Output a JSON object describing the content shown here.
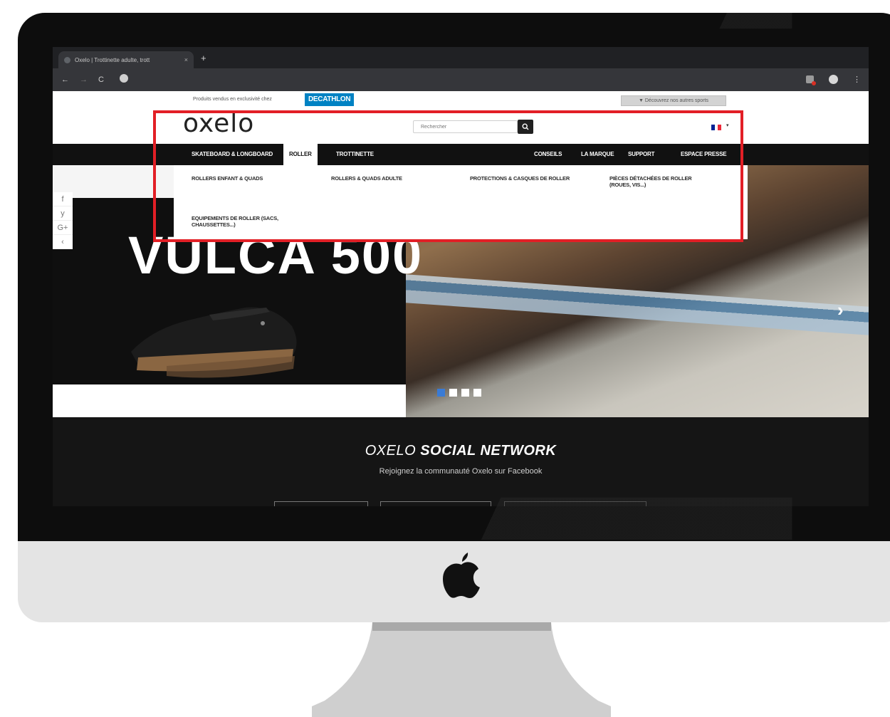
{
  "browser": {
    "tab_title": "Oxelo | Trottinette adulte, trott",
    "tab_close": "×",
    "new_tab": "+",
    "back": "←",
    "forward": "→",
    "reload": "C",
    "menu": "⋮"
  },
  "promo": {
    "text": "Produits vendus en exclusivité chez",
    "brand": "DECATHLON",
    "discover": "▼ Découvrez nos autres sports"
  },
  "header": {
    "logo": "oxelo",
    "search_placeholder": "Rechercher",
    "language_caret": "▾",
    "flag_colors": [
      "#002395",
      "#ffffff",
      "#ed2939"
    ]
  },
  "nav": {
    "left": [
      "SKATEBOARD & LONGBOARD",
      "ROLLER",
      "TROTTINETTE"
    ],
    "right": [
      "CONSEILS",
      "LA MARQUE",
      "SUPPORT",
      "ESPACE PRESSE"
    ],
    "active": "ROLLER"
  },
  "megamenu": {
    "items": [
      "ROLLERS ENFANT & QUADS",
      "ROLLERS & QUADS ADULTE",
      "PROTECTIONS & CASQUES DE ROLLER",
      "PIÈCES DÉTACHÉES DE ROLLER (ROUES, VIS...)",
      "EQUIPEMENTS DE ROLLER (SACS, CHAUSSETTES...)"
    ]
  },
  "hero": {
    "title": "VULCA 500",
    "next": "›",
    "slide_count": 4,
    "active_slide": 1
  },
  "share": {
    "items": [
      "f",
      "y",
      "G+",
      "‹"
    ]
  },
  "social": {
    "title_light": "OXELO",
    "title_bold": "SOCIAL NETWORK",
    "subtitle": "Rejoignez la communauté Oxelo sur Facebook"
  },
  "colors": {
    "accent_highlight": "#e21f26",
    "decathlon_blue": "#0082c3",
    "nav_bg": "#111111",
    "dot_active": "#3a7bd5"
  }
}
